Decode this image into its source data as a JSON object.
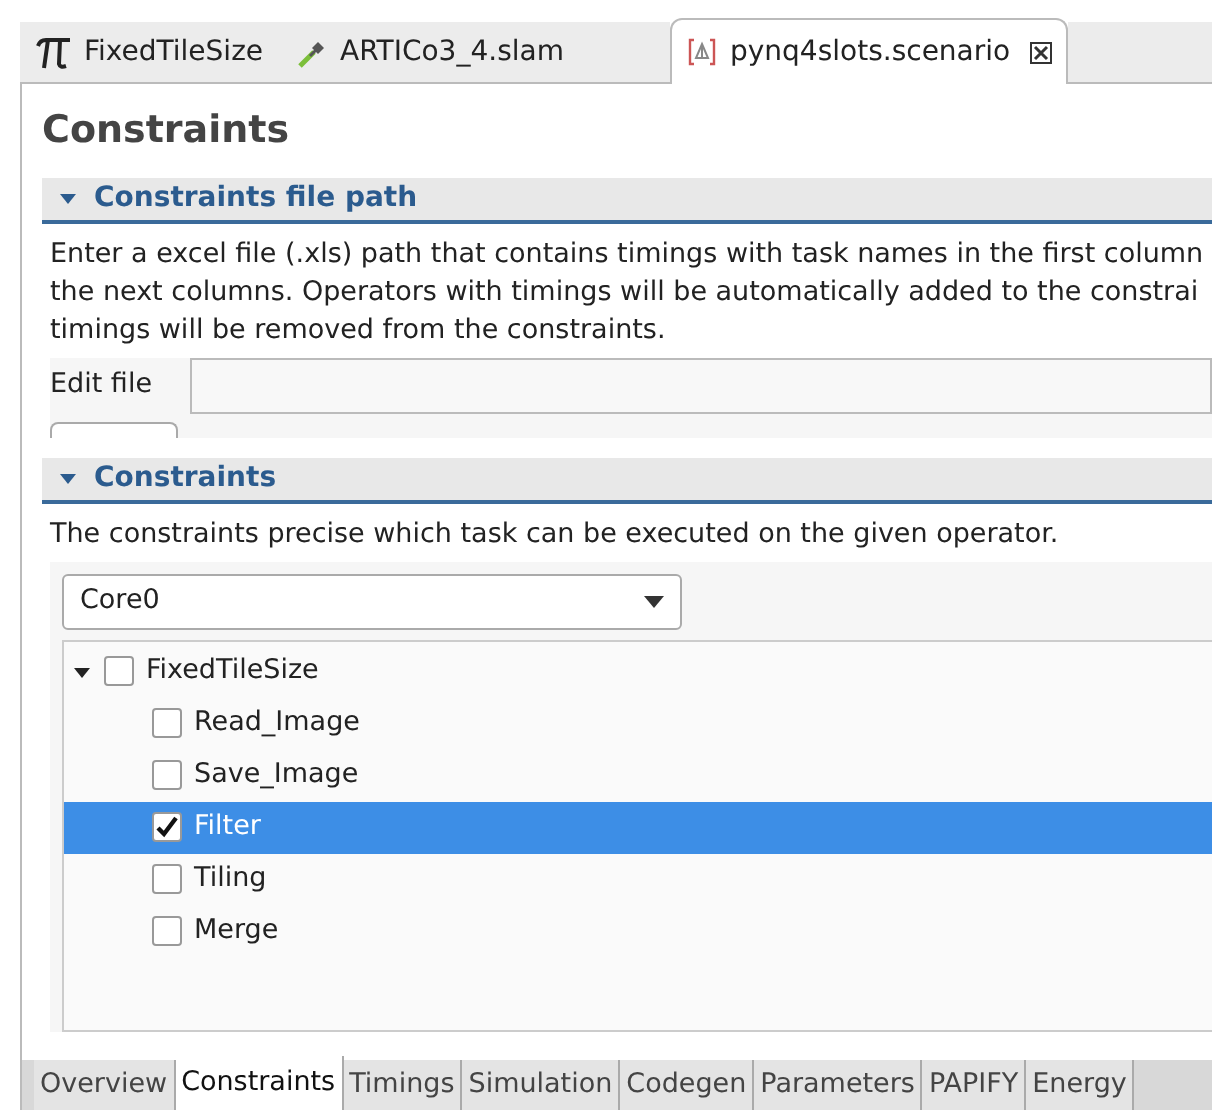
{
  "editor_tabs": [
    {
      "label": "FixedTileSize",
      "kind": "pi",
      "selected": false,
      "closable": false
    },
    {
      "label": "ARTICo3_4.slam",
      "kind": "slam",
      "selected": false,
      "closable": false
    },
    {
      "label": "pynq4slots.scenario",
      "kind": "scenario",
      "selected": true,
      "closable": true
    }
  ],
  "page_title": "Constraints",
  "sections": [
    {
      "title": "Constraints file path",
      "expanded": true,
      "kind": "file",
      "description_lines": [
        "Enter a excel file (.xls) path that contains timings with task names in the first column",
        "the next columns. Operators with timings will be automatically added to the constrai",
        "timings will be removed from the constraints."
      ],
      "field_label": "Edit file"
    },
    {
      "title": "Constraints",
      "expanded": true,
      "kind": "tree",
      "description_lines": [
        "The constraints precise which task can be executed on the given operator."
      ],
      "operator_select": "Core0",
      "tree": [
        {
          "label": "FixedTileSize",
          "checked": false,
          "expanded": true,
          "selected": false,
          "children": [
            {
              "label": "Read_Image",
              "checked": false,
              "selected": false
            },
            {
              "label": "Save_Image",
              "checked": false,
              "selected": false
            },
            {
              "label": "Filter",
              "checked": true,
              "selected": true
            },
            {
              "label": "Tiling",
              "checked": false,
              "selected": false
            },
            {
              "label": "Merge",
              "checked": false,
              "selected": false
            }
          ]
        }
      ]
    }
  ],
  "bottom_tabs": [
    {
      "label": "Overview",
      "selected": false
    },
    {
      "label": "Constraints",
      "selected": true
    },
    {
      "label": "Timings",
      "selected": false
    },
    {
      "label": "Simulation",
      "selected": false
    },
    {
      "label": "Codegen",
      "selected": false
    },
    {
      "label": "Parameters",
      "selected": false
    },
    {
      "label": "PAPIFY",
      "selected": false
    },
    {
      "label": "Energy",
      "selected": false
    }
  ]
}
